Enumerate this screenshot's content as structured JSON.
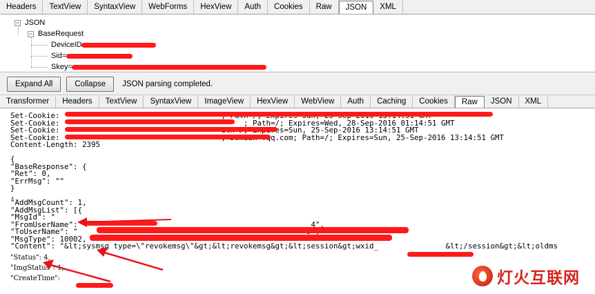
{
  "top_tabs": [
    "Headers",
    "TextView",
    "SyntaxView",
    "WebForms",
    "HexView",
    "Auth",
    "Cookies",
    "Raw",
    "JSON",
    "XML"
  ],
  "top_active": "JSON",
  "tree": {
    "root": "JSON",
    "child": "BaseRequest",
    "leaves": [
      "DeviceID=",
      "Sid=",
      "Skey="
    ]
  },
  "actions": {
    "expand_all": "Expand All",
    "collapse": "Collapse",
    "status": "JSON parsing completed."
  },
  "bottom_tabs": [
    "Transformer",
    "Headers",
    "TextView",
    "SyntaxView",
    "ImageView",
    "HexView",
    "WebView",
    "Auth",
    "Caching",
    "Cookies",
    "Raw",
    "JSON",
    "XML"
  ],
  "bottom_active": "Raw",
  "raw_lines": [
    "Set-Cookie:                                    ; Path=/; Expires=Sun, 25-Sep-2016 13:14:51 GMT",
    "Set-Cookie:                                         ; Path=/; Expires=Wed, 28-Sep-2016 01:14:51 GMT",
    "Set-Cookie:                                    ath=/; Expires=Sun, 25-Sep-2016 13:14:51 GMT",
    "Set-Cookie:                                    ; Domain=.qq.com; Path=/; Expires=Sun, 25-Sep-2016 13:14:51 GMT",
    "Content-Length: 2395",
    "",
    "{",
    "\"BaseResponse\": {",
    "\"Ret\": 0,",
    "\"ErrMsg\": \"\"",
    "}",
    ",",
    "\"AddMsgCount\": 1,",
    "\"AddMsgList\": [{",
    "\"MsgId\": \"",
    "\"FromUserName\": \"                                                  4\",",
    "\"ToUserName\": \"                                                   9\",",
    "\"MsgType\": 10002,",
    "\"Content\": \"&lt;sysmsg type=\\\"revokemsg\\\"&gt;&lt;revokemsg&gt;&lt;session&gt;wxid_               &lt;/session&gt;&lt;oldms"
  ],
  "raw_tail": [
    "\"Status\": 4,",
    "\"ImgStatus\": 1,",
    "\"CreateTime\": "
  ],
  "watermark": "灯火互联网",
  "colors": {
    "redaction": "#ff1a1a",
    "arrow": "#e8141b",
    "watermark": "#d8251b"
  }
}
